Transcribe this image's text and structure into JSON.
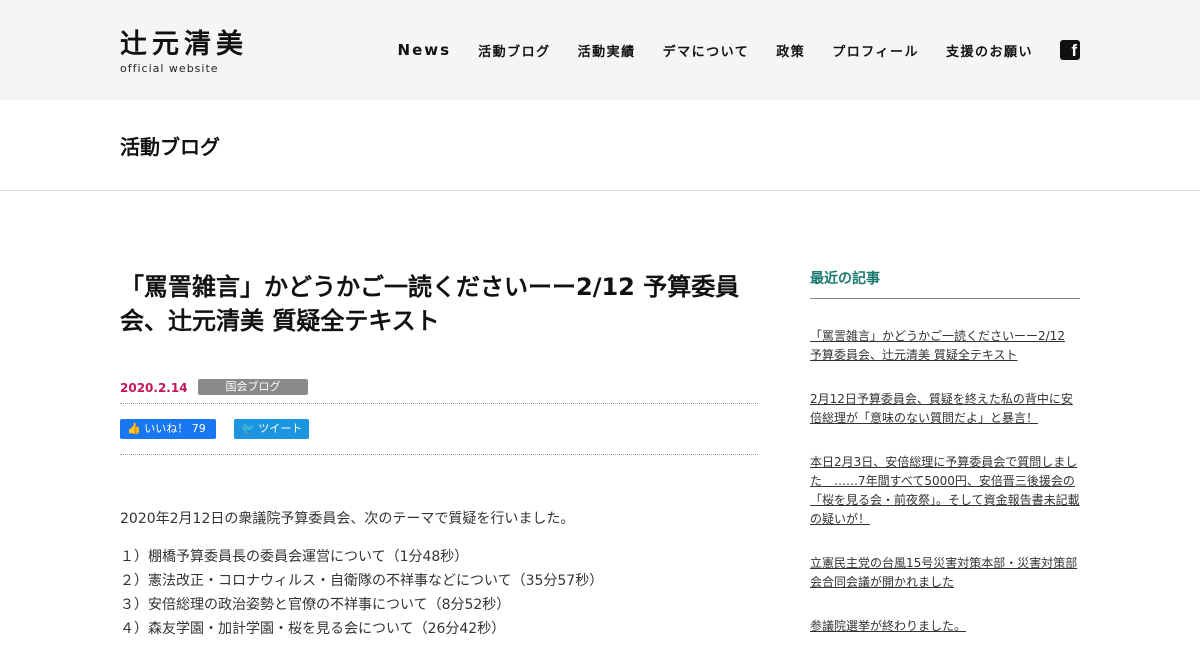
{
  "header": {
    "logo_name": "辻元清美",
    "logo_sub": "official website",
    "nav": [
      "News",
      "活動ブログ",
      "活動実績",
      "デマについて",
      "政策",
      "プロフィール",
      "支援のお願い"
    ],
    "fb_icon": "facebook-icon",
    "fb_glyph": "f"
  },
  "page": {
    "title": "活動ブログ"
  },
  "article": {
    "title": "「罵詈雑言」かどうかご一読くださいーー2/12 予算委員会、辻元清美 質疑全テキスト",
    "date": "2020.2.14",
    "category": "国会ブログ",
    "like_label": "👍 いいね！ 79",
    "tweet_label": "🐦 ツイート",
    "intro": "2020年2月12日の衆議院予算委員会、次のテーマで質疑を行いました。",
    "items": [
      "１）棚橋予算委員長の委員会運営について（1分48秒）",
      "２）憲法改正・コロナウィルス・自衛隊の不祥事などについて（35分57秒）",
      "３）安倍総理の政治姿勢と官僚の不祥事について（8分52秒）",
      "４）森友学園・加計学園・桜を見る会について（26分42秒）"
    ]
  },
  "sidebar": {
    "heading": "最近の記事",
    "items": [
      "「罵詈雑言」かどうかご一読くださいーー2/12 予算委員会、辻元清美 質疑全テキスト",
      "2月12日予算委員会、質疑を終えた私の背中に安倍総理が「意味のない質問だよ」と暴言！",
      "本日2月3日、安倍総理に予算委員会で質問しました　……7年間すべて5000円、安倍晋三後援会の「桜を見る会・前夜祭」。そして資金報告書未記載の疑いが！",
      "立憲民主党の台風15号災害対策本部・災害対策部会合同会議が開かれました",
      "参議院選挙が終わりました。"
    ]
  }
}
